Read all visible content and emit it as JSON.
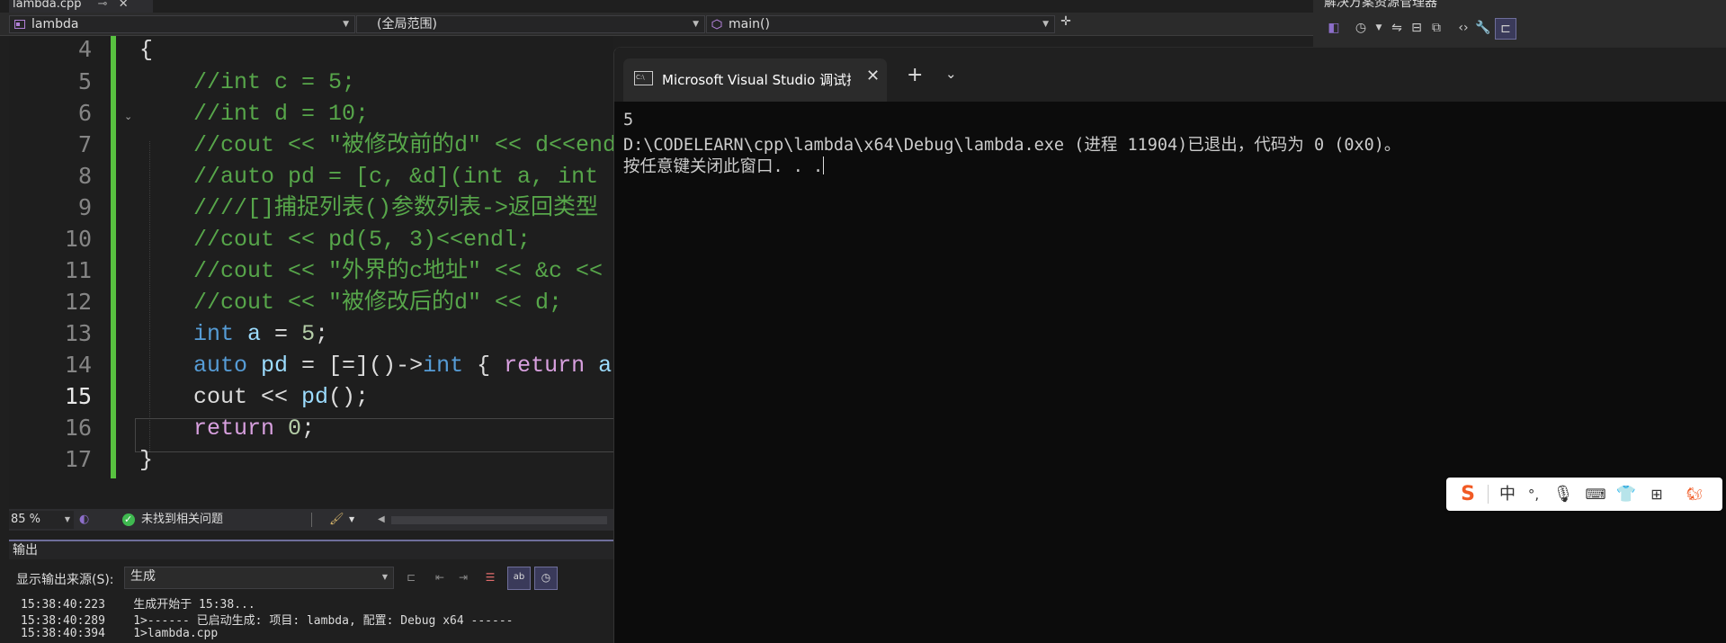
{
  "editor_tab": {
    "filename": "lambda.cpp"
  },
  "nav": {
    "project": "lambda",
    "scope": "(全局范围)",
    "member": "main()"
  },
  "code": {
    "line_numbers": [
      "4",
      "5",
      "6",
      "7",
      "8",
      "9",
      "10",
      "11",
      "12",
      "13",
      "14",
      "15",
      "16",
      "17"
    ],
    "current_line": "15"
  },
  "editor_status": {
    "zoom": "85 %",
    "issues": "未找到相关问题"
  },
  "output": {
    "title": "输出",
    "source_label": "显示输出来源(S):",
    "source_value": "生成",
    "lines": [
      {
        "time": "15:38:40:223",
        "text": "生成开始于 15:38..."
      },
      {
        "time": "15:38:40:289",
        "text": "1>------ 已启动生成: 项目: lambda, 配置: Debug x64 ------"
      },
      {
        "time": "15:38:40:394",
        "text": "1>lambda.cpp"
      }
    ]
  },
  "solution_explorer": {
    "title": "解决方案资源管理器"
  },
  "console": {
    "tab_title": "Microsoft Visual Studio 调试控制台",
    "tab_icon": "C:\\",
    "lines": [
      "5",
      "D:\\CODELEARN\\cpp\\lambda\\x64\\Debug\\lambda.exe (进程 11904)已退出，代码为 0 (0x0)。",
      "按任意键关闭此窗口. . ."
    ]
  },
  "ime": {
    "logo": "S",
    "mode": "中",
    "punct": "°,"
  },
  "colors": {
    "comment": "#57a64a",
    "keyword": "#569cd6",
    "control": "#d8a0df",
    "identifier": "#9cdcfe",
    "number": "#b5cea8",
    "change_bar": "#58c140",
    "console_bg": "#0c0c0c",
    "editor_bg": "#1e1e1e"
  }
}
